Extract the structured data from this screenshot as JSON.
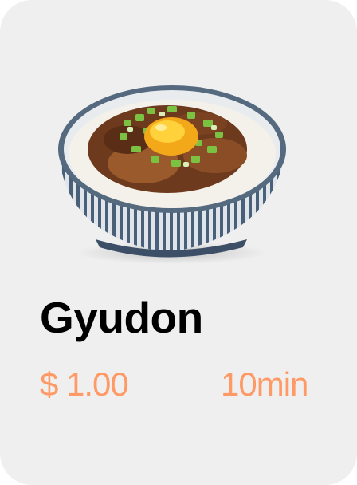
{
  "item": {
    "name": "Gyudon",
    "price": "$ 1.00",
    "time": "10min",
    "image": "gyudon-bowl-image"
  },
  "colors": {
    "card_bg": "#efefef",
    "accent": "#ff9966",
    "title": "#000000"
  }
}
